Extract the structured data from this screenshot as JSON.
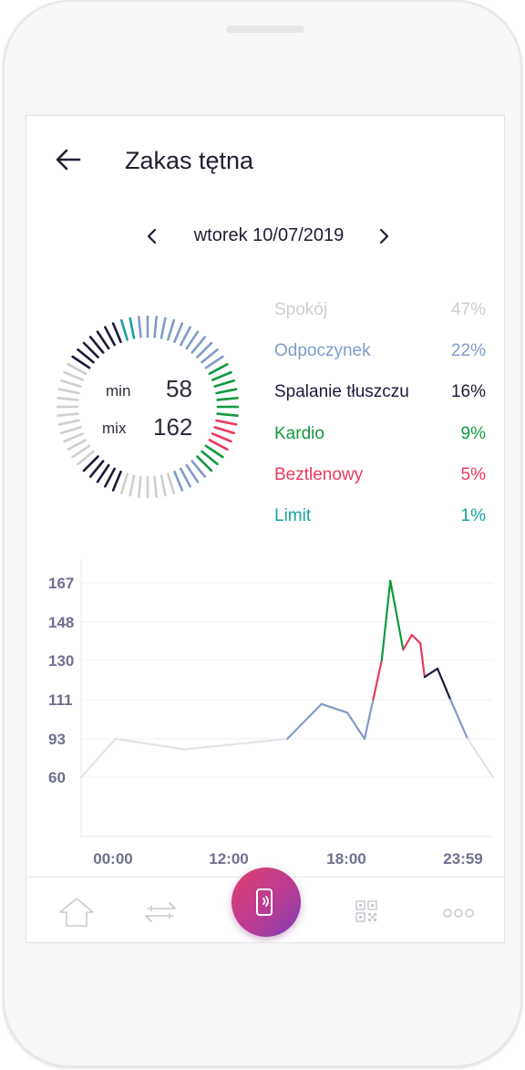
{
  "header": {
    "title": "Zakas tętna",
    "back_icon": "arrow-left-icon"
  },
  "date_nav": {
    "label": "wtorek 10/07/2019",
    "prev_icon": "chevron-left-icon",
    "next_icon": "chevron-right-icon"
  },
  "summary": {
    "min_label": "min",
    "min_value": "58",
    "max_label": "mix",
    "max_value": "162"
  },
  "zones": [
    {
      "name": "Spokój",
      "percent": "47%",
      "color": "#cfcfcf"
    },
    {
      "name": "Odpoczynek",
      "percent": "22%",
      "color": "#7f9cc9"
    },
    {
      "name": "Spalanie tłuszczu",
      "percent": "16%",
      "color": "#1b1a3a"
    },
    {
      "name": "Kardio",
      "percent": "9%",
      "color": "#0f9a3e"
    },
    {
      "name": "Beztlenowy",
      "percent": "5%",
      "color": "#e83a5e"
    },
    {
      "name": "Limit",
      "percent": "1%",
      "color": "#17a3a3"
    }
  ],
  "chart_data": {
    "type": "line",
    "y_ticks": [
      "167",
      "148",
      "130",
      "111",
      "93",
      "60"
    ],
    "x_ticks": [
      "00:00",
      "12:00",
      "18:00",
      "23:59"
    ],
    "grid": true,
    "series": [
      {
        "points": [
          {
            "t": "00:00",
            "bpm": 60
          },
          {
            "t": "02:00",
            "bpm": 93
          },
          {
            "t": "06:00",
            "bpm": 84
          },
          {
            "t": "12:00",
            "bpm": 93
          },
          {
            "t": "14:00",
            "bpm": 109
          },
          {
            "t": "15:30",
            "bpm": 105
          },
          {
            "t": "16:30",
            "bpm": 93
          },
          {
            "t": "17:00",
            "bpm": 111
          },
          {
            "t": "17:30",
            "bpm": 130
          },
          {
            "t": "18:00",
            "bpm": 168
          },
          {
            "t": "18:45",
            "bpm": 135
          },
          {
            "t": "19:15",
            "bpm": 142
          },
          {
            "t": "19:45",
            "bpm": 138
          },
          {
            "t": "20:00",
            "bpm": 122
          },
          {
            "t": "20:45",
            "bpm": 126
          },
          {
            "t": "21:30",
            "bpm": 111
          },
          {
            "t": "22:30",
            "bpm": 93
          },
          {
            "t": "23:59",
            "bpm": 60
          }
        ]
      }
    ]
  },
  "bottom_nav": {
    "items": [
      "home-icon",
      "transfer-icon",
      "phone-contactless-icon",
      "qr-code-icon",
      "more-icon"
    ]
  }
}
